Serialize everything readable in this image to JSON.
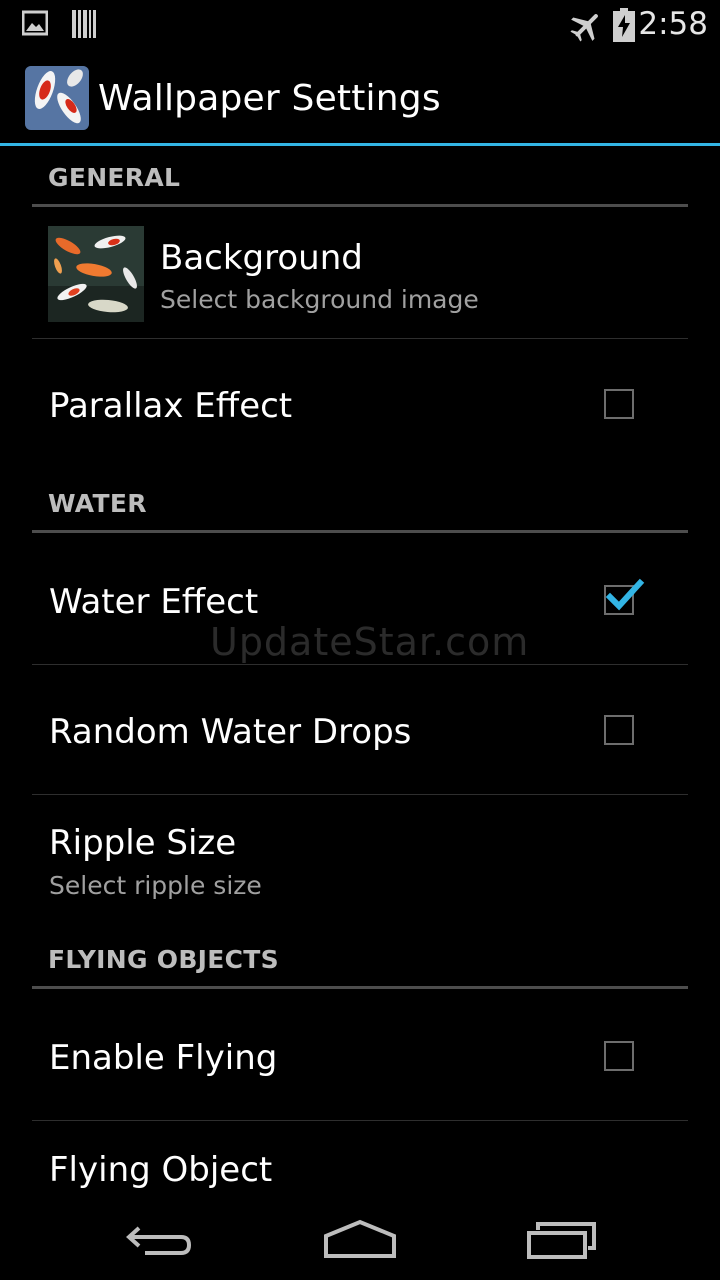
{
  "status_bar": {
    "time": "2:58",
    "left_icons": [
      "picture-icon",
      "barcode-icon"
    ],
    "right_icons": [
      "airplane-mode-icon",
      "battery-charging-icon"
    ]
  },
  "action_bar": {
    "title": "Wallpaper Settings",
    "accent_color": "#33b5e5"
  },
  "sections": {
    "general": {
      "header": "GENERAL",
      "background": {
        "title": "Background",
        "summary": "Select background image"
      },
      "parallax": {
        "title": "Parallax Effect",
        "checked": false
      }
    },
    "water": {
      "header": "WATER",
      "water_effect": {
        "title": "Water Effect",
        "checked": true
      },
      "random_drops": {
        "title": "Random Water Drops",
        "checked": false
      },
      "ripple_size": {
        "title": "Ripple Size",
        "summary": "Select ripple size"
      }
    },
    "flying": {
      "header": "FLYING OBJECTS",
      "enable_flying": {
        "title": "Enable Flying",
        "checked": false
      },
      "flying_object": {
        "title": "Flying Object"
      }
    }
  },
  "watermark": "UpdateStar.com",
  "nav_bar": {
    "buttons": [
      "back-icon",
      "home-icon",
      "recent-apps-icon"
    ]
  }
}
